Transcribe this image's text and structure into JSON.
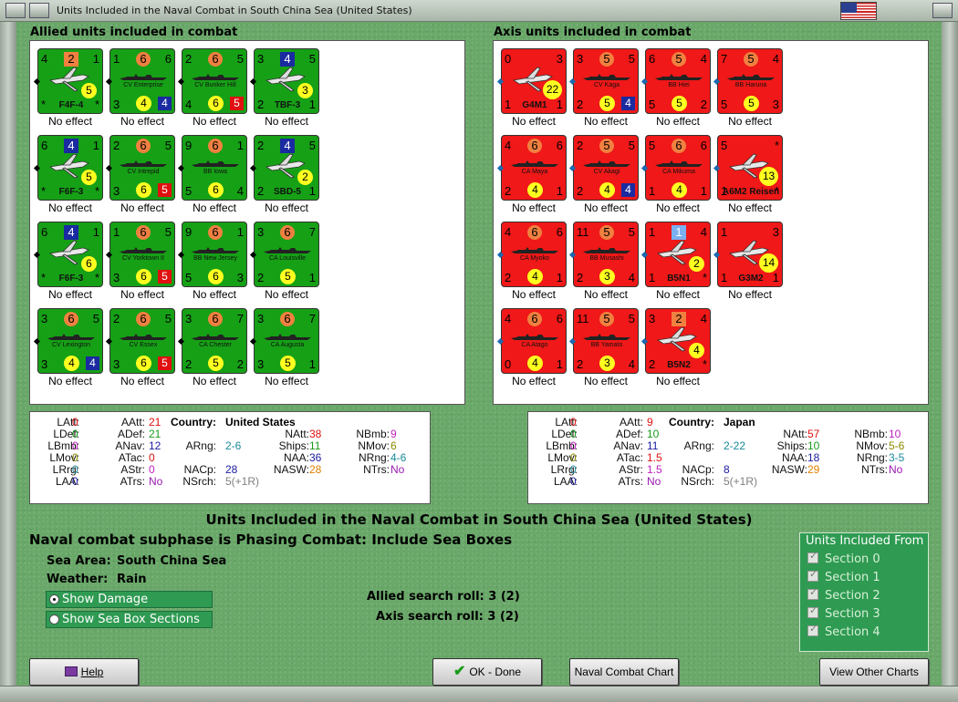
{
  "window": {
    "title": "Units Included in the Naval Combat in South China Sea (United States)"
  },
  "allied_heading": "Allied units included in combat",
  "axis_heading": "Axis units included in combat",
  "allied_units": [
    {
      "name": "F4F-4",
      "kind": "plane",
      "tl": "4",
      "tm": "2",
      "tmstyle": "sq",
      "tr": "1",
      "y": "5",
      "bl": "*",
      "br": "*"
    },
    {
      "name": "CV Enterprise",
      "kind": "ship",
      "tl": "1",
      "tm": "6",
      "tr": "6",
      "bl": "3",
      "bm": "4",
      "br": "4",
      "brbox": "blue"
    },
    {
      "name": "CV Bunker Hill",
      "kind": "ship",
      "tl": "2",
      "tm": "6",
      "tr": "5",
      "bl": "4",
      "bm": "6",
      "br": "5",
      "brbox": "red"
    },
    {
      "name": "TBF-3",
      "kind": "plane",
      "tl": "3",
      "tm": "4",
      "tmstyle": "sqb",
      "tr": "5",
      "y": "3",
      "bl": "2",
      "br": "1"
    },
    {
      "name": "F6F-3",
      "kind": "plane",
      "tl": "6",
      "tm": "4",
      "tmstyle": "sqb",
      "tr": "1",
      "y": "5",
      "bl": "*",
      "br": "*"
    },
    {
      "name": "CV Intrepid",
      "kind": "ship",
      "tl": "2",
      "tm": "6",
      "tr": "5",
      "bl": "3",
      "bm": "6",
      "br": "5",
      "brbox": "red"
    },
    {
      "name": "BB Iowa",
      "kind": "ship",
      "tl": "9",
      "tm": "6",
      "tr": "1",
      "bl": "5",
      "bm": "6",
      "br": "4"
    },
    {
      "name": "SBD-5",
      "kind": "plane",
      "tl": "2",
      "tm": "4",
      "tmstyle": "sqb",
      "tr": "5",
      "y": "2",
      "bl": "2",
      "br": "1"
    },
    {
      "name": "F6F-3",
      "kind": "plane",
      "tl": "6",
      "tm": "4",
      "tmstyle": "sqb",
      "tr": "1",
      "y": "6",
      "bl": "*",
      "br": "*"
    },
    {
      "name": "CV Yorktown II",
      "kind": "ship",
      "tl": "1",
      "tm": "6",
      "tr": "5",
      "bl": "3",
      "bm": "6",
      "br": "5",
      "brbox": "red"
    },
    {
      "name": "BB New Jersey",
      "kind": "ship",
      "tl": "9",
      "tm": "6",
      "tr": "1",
      "bl": "5",
      "bm": "6",
      "br": "3"
    },
    {
      "name": "CA Louisville",
      "kind": "ship",
      "tl": "3",
      "tm": "6",
      "tr": "7",
      "bl": "2",
      "bm": "5",
      "br": "1"
    },
    {
      "name": "CV Lexington",
      "kind": "ship",
      "tl": "3",
      "tm": "6",
      "tr": "5",
      "bl": "3",
      "bm": "4",
      "br": "4",
      "brbox": "blue"
    },
    {
      "name": "CV Essex",
      "kind": "ship",
      "tl": "2",
      "tm": "6",
      "tr": "5",
      "bl": "3",
      "bm": "6",
      "br": "5",
      "brbox": "red"
    },
    {
      "name": "CA Chester",
      "kind": "ship",
      "tl": "3",
      "tm": "6",
      "tr": "7",
      "bl": "2",
      "bm": "5",
      "br": "2"
    },
    {
      "name": "CA Augusta",
      "kind": "ship",
      "tl": "3",
      "tm": "6",
      "tr": "7",
      "bl": "3",
      "bm": "5",
      "br": "1"
    }
  ],
  "axis_units": [
    {
      "name": "G4M1",
      "kind": "plane",
      "tl": "0",
      "tm": "",
      "tr": "3",
      "y": "22",
      "bl": "1",
      "br": "1"
    },
    {
      "name": "CV Kaga",
      "kind": "ship",
      "tl": "3",
      "tm": "5",
      "tr": "5",
      "bl": "2",
      "bm": "5",
      "br": "4",
      "brbox": "blue"
    },
    {
      "name": "BB Hiei",
      "kind": "ship",
      "tl": "6",
      "tm": "5",
      "tr": "4",
      "bl": "5",
      "bm": "5",
      "br": "2"
    },
    {
      "name": "BB Haruna",
      "kind": "ship",
      "tl": "7",
      "tm": "5",
      "tr": "4",
      "bl": "5",
      "bm": "5",
      "br": "3"
    },
    {
      "name": "CA Maya",
      "kind": "ship",
      "tl": "4",
      "tm": "6",
      "tr": "6",
      "bl": "2",
      "bm": "4",
      "br": "1"
    },
    {
      "name": "CV Akagi",
      "kind": "ship",
      "tl": "2",
      "tm": "5",
      "tr": "5",
      "bl": "2",
      "bm": "4",
      "br": "4",
      "brbox": "blue"
    },
    {
      "name": "CA Mikuma",
      "kind": "ship",
      "tl": "5",
      "tm": "6",
      "tr": "6",
      "bl": "1",
      "bm": "4",
      "br": "1"
    },
    {
      "name": "A6M2 Reisen",
      "kind": "plane",
      "tl": "5",
      "tm": "",
      "tr": "*",
      "y": "13",
      "bl": "1",
      "br": "*"
    },
    {
      "name": "CA Myoko",
      "kind": "ship",
      "tl": "4",
      "tm": "6",
      "tr": "6",
      "bl": "2",
      "bm": "4",
      "br": "1"
    },
    {
      "name": "BB Musashi",
      "kind": "ship",
      "tl": "11",
      "tm": "5",
      "tr": "5",
      "bl": "2",
      "bm": "3",
      "br": "4"
    },
    {
      "name": "B5N1",
      "kind": "plane",
      "tl": "1",
      "tm": "1",
      "tmstyle": "sql",
      "tr": "4",
      "y": "2",
      "bl": "1",
      "br": "*"
    },
    {
      "name": "G3M2",
      "kind": "plane",
      "tl": "1",
      "tm": "",
      "tr": "3",
      "y": "14",
      "bl": "1",
      "br": "1"
    },
    {
      "name": "CA Atago",
      "kind": "ship",
      "tl": "4",
      "tm": "6",
      "tr": "6",
      "bl": "0",
      "bm": "4",
      "br": "1"
    },
    {
      "name": "BB Yamato",
      "kind": "ship",
      "tl": "11",
      "tm": "5",
      "tr": "5",
      "bl": "2",
      "bm": "3",
      "br": "4"
    },
    {
      "name": "B5N2",
      "kind": "plane",
      "tl": "3",
      "tm": "2",
      "tmstyle": "sq",
      "tr": "4",
      "y": "4",
      "bl": "2",
      "br": "*"
    }
  ],
  "effect_text": "No effect",
  "allied_stats": {
    "country_label": "Country:",
    "country": "United States",
    "LAtt": "0",
    "LDef": "0",
    "LBmb": "0",
    "LMov": "0",
    "LRrg": "0",
    "LAA": "0",
    "AAtt": "21",
    "ADef": "21",
    "ANav": "12",
    "ATac": "0",
    "AStr": "0",
    "ATrs": "No",
    "ARng": "2-6",
    "NACp": "28",
    "NSrch": "5(+1R)",
    "NAtt": "38",
    "Ships": "11",
    "NAA": "36",
    "NASW": "28",
    "NBmb": "9",
    "NMov": "6",
    "NRng": "4-6",
    "NTrs": "No"
  },
  "axis_stats": {
    "country_label": "Country:",
    "country": "Japan",
    "LAtt": "0",
    "LDef": "0",
    "LBmb": "0",
    "LMov": "0",
    "LRrg": "0",
    "LAA": "0",
    "AAtt": "9",
    "ADef": "10",
    "ANav": "11",
    "ATac": "1.5",
    "AStr": "1.5",
    "ATrs": "No",
    "ARng": "2-22",
    "NACp": "8",
    "NSrch": "5(+1R)",
    "NAtt": "57",
    "Ships": "10",
    "NAA": "18",
    "NASW": "29",
    "NBmb": "10",
    "NMov": "5-6",
    "NRng": "3-5",
    "NTrs": "No"
  },
  "center_title": "Units Included in the Naval Combat in South China Sea (United States)",
  "subphase": "Naval combat subphase is Phasing Combat: Include Sea Boxes",
  "sea_area_label": "Sea Area:",
  "sea_area": "South China Sea",
  "weather_label": "Weather:",
  "weather": "Rain",
  "show_damage": "Show Damage",
  "show_sections": "Show Sea Box Sections",
  "allied_search": "Allied search roll: 3 (2)",
  "axis_search": "Axis search roll: 3 (2)",
  "sections": {
    "legend": "Units Included From",
    "items": [
      "Section 0",
      "Section 1",
      "Section 2",
      "Section 3",
      "Section 4"
    ]
  },
  "buttons": {
    "help": "Help",
    "ok": "OK - Done",
    "naval_chart": "Naval Combat Chart",
    "other_charts": "View Other Charts"
  },
  "colors": {
    "allied": "#16a016",
    "axis": "#f01818",
    "panel": "#2e9a52"
  }
}
